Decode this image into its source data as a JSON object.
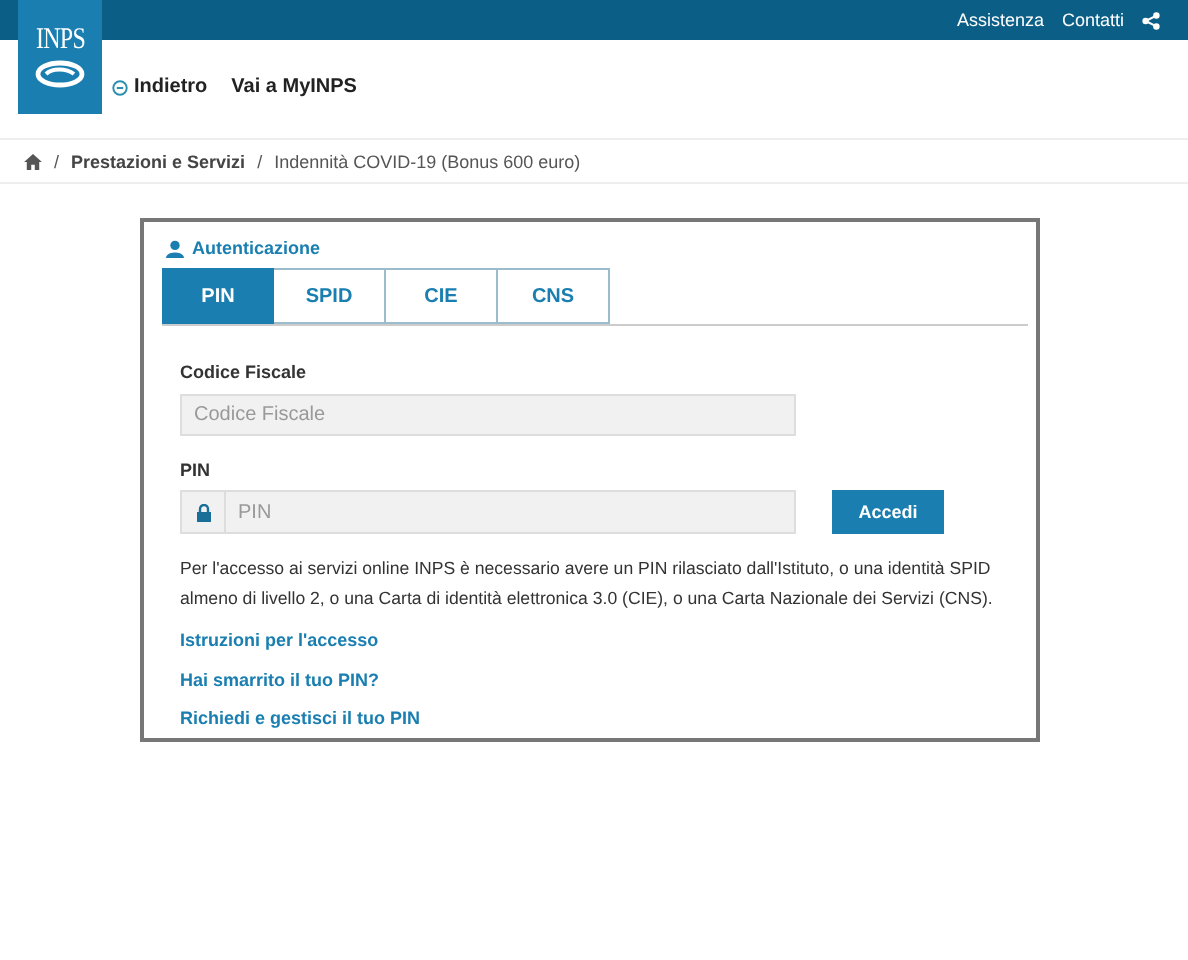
{
  "logo": {
    "text": "INPS"
  },
  "top_bar": {
    "links": [
      "Assistenza",
      "Contatti"
    ]
  },
  "header": {
    "back": "Indietro",
    "myinps": "Vai a MyINPS"
  },
  "breadcrumb": {
    "separator": "/",
    "items": [
      "Prestazioni e Servizi",
      "Indennità COVID-19 (Bonus 600 euro)"
    ]
  },
  "auth": {
    "title": "Autenticazione",
    "tabs": [
      {
        "label": "PIN",
        "selected": true
      },
      {
        "label": "SPID",
        "selected": false
      },
      {
        "label": "CIE",
        "selected": false
      },
      {
        "label": "CNS",
        "selected": false
      }
    ],
    "fiscal_code": {
      "label": "Codice Fiscale",
      "placeholder": "Codice Fiscale"
    },
    "pin": {
      "label": "PIN",
      "placeholder": "PIN"
    },
    "submit": "Accedi",
    "info": "Per l'accesso ai servizi online INPS è necessario avere un PIN rilasciato dall'Istituto, o una identità SPID almeno di livello 2, o una Carta di identità elettronica 3.0 (CIE), o una Carta Nazionale dei Servizi (CNS).",
    "links": [
      "Istruzioni per l'accesso",
      "Hai smarrito il tuo PIN?",
      "Richiedi e gestisci il tuo PIN"
    ]
  }
}
